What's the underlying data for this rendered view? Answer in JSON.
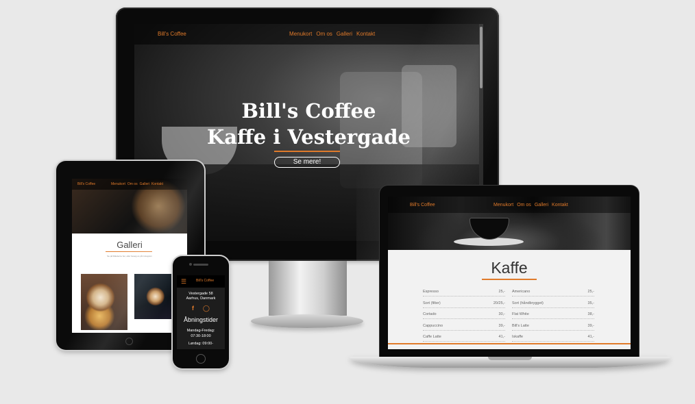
{
  "monitor": {
    "brand": "Bill's Coffee",
    "menu": [
      "Menukort",
      "Om os",
      "Galleri",
      "Kontakt"
    ],
    "title_line1": "Bill's Coffee",
    "title_line2": "Kaffe i Vestergade",
    "button": "Se mere!"
  },
  "tablet": {
    "brand": "Bill's Coffee",
    "menu": [
      "Menukort",
      "Om os",
      "Galleri",
      "Kontakt"
    ],
    "heading": "Galleri",
    "subtitle": "Se på billederne her, eller besøg os på Instagram"
  },
  "laptop": {
    "brand": "Bill's Coffee",
    "menu": [
      "Menukort",
      "Om os",
      "Galleri",
      "Kontakt"
    ],
    "heading": "Kaffe",
    "left_items": [
      {
        "name": "Espresso",
        "price": "25,-"
      },
      {
        "name": "Sort (filter)",
        "price": "20/25,-"
      },
      {
        "name": "Cortado",
        "price": "30,-"
      },
      {
        "name": "Cappuccino",
        "price": "39,-"
      },
      {
        "name": "Caffe Latte",
        "price": "41,-"
      }
    ],
    "right_items": [
      {
        "name": "Americano",
        "price": "25,-"
      },
      {
        "name": "Sort (håndbrygget)",
        "price": "35,-"
      },
      {
        "name": "Flat White",
        "price": "38,-"
      },
      {
        "name": "Bill's Latte",
        "price": "39,-"
      },
      {
        "name": "Iskaffe",
        "price": "41,-"
      }
    ]
  },
  "phone": {
    "brand": "Bill's Coffee",
    "address_line1": "Vestergade 58",
    "address_line2": "Aarhus, Danmark",
    "heading": "Åbningstider",
    "hours_line1": "Mandag-Fredag:",
    "hours_line2": "07:30-18:00",
    "hours_line3": "Lørdag: 09:00-"
  },
  "colors": {
    "accent": "#e07a2a",
    "background": "#e9e9e9"
  }
}
